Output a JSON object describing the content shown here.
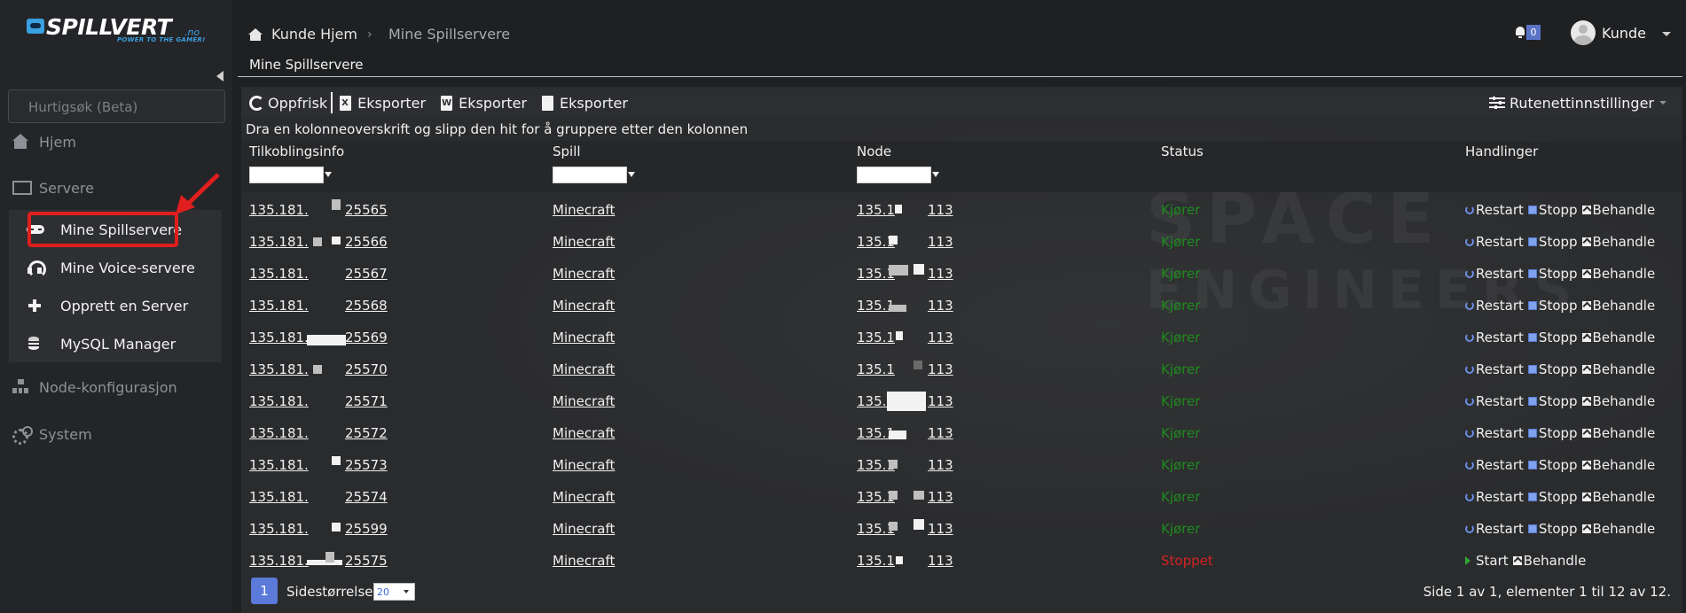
{
  "brand": {
    "name": "SPILLVERT",
    "tld": ".no",
    "tagline": "POWER TO THE GAMER!"
  },
  "sidebar": {
    "search_placeholder": "Hurtigsøk (Beta)",
    "items": [
      {
        "label": "Hjem",
        "icon": "home-icon"
      },
      {
        "label": "Servere",
        "icon": "monitor-icon"
      },
      {
        "label": "Node-konfigurasjon",
        "icon": "network-icon"
      },
      {
        "label": "System",
        "icon": "gears-icon"
      }
    ],
    "submenu": [
      {
        "label": "Mine Spillservere",
        "icon": "gamepad-icon",
        "active": true
      },
      {
        "label": "Mine Voice-servere",
        "icon": "headset-icon"
      },
      {
        "label": "Opprett en Server",
        "icon": "plus-icon"
      },
      {
        "label": "MySQL Manager",
        "icon": "database-icon"
      }
    ]
  },
  "header": {
    "breadcrumb_home": "Kunde Hjem",
    "breadcrumb_sep": "›",
    "breadcrumb_current": "Mine Spillservere",
    "notification_count": "0",
    "user_name": "Kunde"
  },
  "panel": {
    "title": "Mine Spillservere"
  },
  "toolbar": {
    "refresh": "Oppfrisk",
    "export_excel": "Eksporter",
    "export_word": "Eksporter",
    "export_pdf": "Eksporter",
    "grid_settings": "Rutenettinnstillinger",
    "excel_letter": "X",
    "word_letter": "W"
  },
  "grid": {
    "group_hint": "Dra en kolonneoverskrift og slipp den hit for å gruppere etter den kolonnen",
    "columns": [
      "Tilkoblingsinfo",
      "Spill",
      "Node",
      "Status",
      "Handlinger"
    ],
    "rows": [
      {
        "ip_prefix": "135.181.",
        "port": "25565",
        "game": "Minecraft",
        "node_prefix": "135.1",
        "node_suffix": "113",
        "status": "Kjører"
      },
      {
        "ip_prefix": "135.181.",
        "port": "25566",
        "game": "Minecraft",
        "node_prefix": "135.1",
        "node_suffix": "113",
        "status": "Kjører"
      },
      {
        "ip_prefix": "135.181.",
        "port": "25567",
        "game": "Minecraft",
        "node_prefix": "135.1",
        "node_suffix": "113",
        "status": "Kjører"
      },
      {
        "ip_prefix": "135.181.",
        "port": "25568",
        "game": "Minecraft",
        "node_prefix": "135.1",
        "node_suffix": "113",
        "status": "Kjører"
      },
      {
        "ip_prefix": "135.181.",
        "port": "25569",
        "game": "Minecraft",
        "node_prefix": "135.1",
        "node_suffix": "113",
        "status": "Kjører"
      },
      {
        "ip_prefix": "135.181.",
        "port": "25570",
        "game": "Minecraft",
        "node_prefix": "135.1",
        "node_suffix": "113",
        "status": "Kjører"
      },
      {
        "ip_prefix": "135.181.",
        "port": "25571",
        "game": "Minecraft",
        "node_prefix": "135.1",
        "node_suffix": "113",
        "status": "Kjører"
      },
      {
        "ip_prefix": "135.181.",
        "port": "25572",
        "game": "Minecraft",
        "node_prefix": "135.1",
        "node_suffix": "113",
        "status": "Kjører"
      },
      {
        "ip_prefix": "135.181.",
        "port": "25573",
        "game": "Minecraft",
        "node_prefix": "135.1",
        "node_suffix": "113",
        "status": "Kjører"
      },
      {
        "ip_prefix": "135.181.",
        "port": "25574",
        "game": "Minecraft",
        "node_prefix": "135.1",
        "node_suffix": "113",
        "status": "Kjører"
      },
      {
        "ip_prefix": "135.181.",
        "port": "25599",
        "game": "Minecraft",
        "node_prefix": "135.1",
        "node_suffix": "113",
        "status": "Kjører"
      },
      {
        "ip_prefix": "135.181.",
        "port": "25575",
        "game": "Minecraft",
        "node_prefix": "135.1",
        "node_suffix": "113",
        "status": "Stoppet"
      }
    ],
    "actions_running": [
      "Restart",
      "Stopp",
      "Behandle"
    ],
    "actions_stopped": [
      "Start",
      "Behandle"
    ]
  },
  "footer": {
    "current_page": "1",
    "page_size_label": "Sidestørrelse:",
    "page_size": "20",
    "page_info": "Side 1 av 1, elementer 1 til 12 av 12."
  },
  "background_watermark": [
    "SPACE",
    "ENGINEERS"
  ],
  "colors": {
    "running": "#1e8a1e",
    "stopped": "#d22222",
    "accent": "#5b7ad9",
    "highlight": "#e01e1e"
  }
}
